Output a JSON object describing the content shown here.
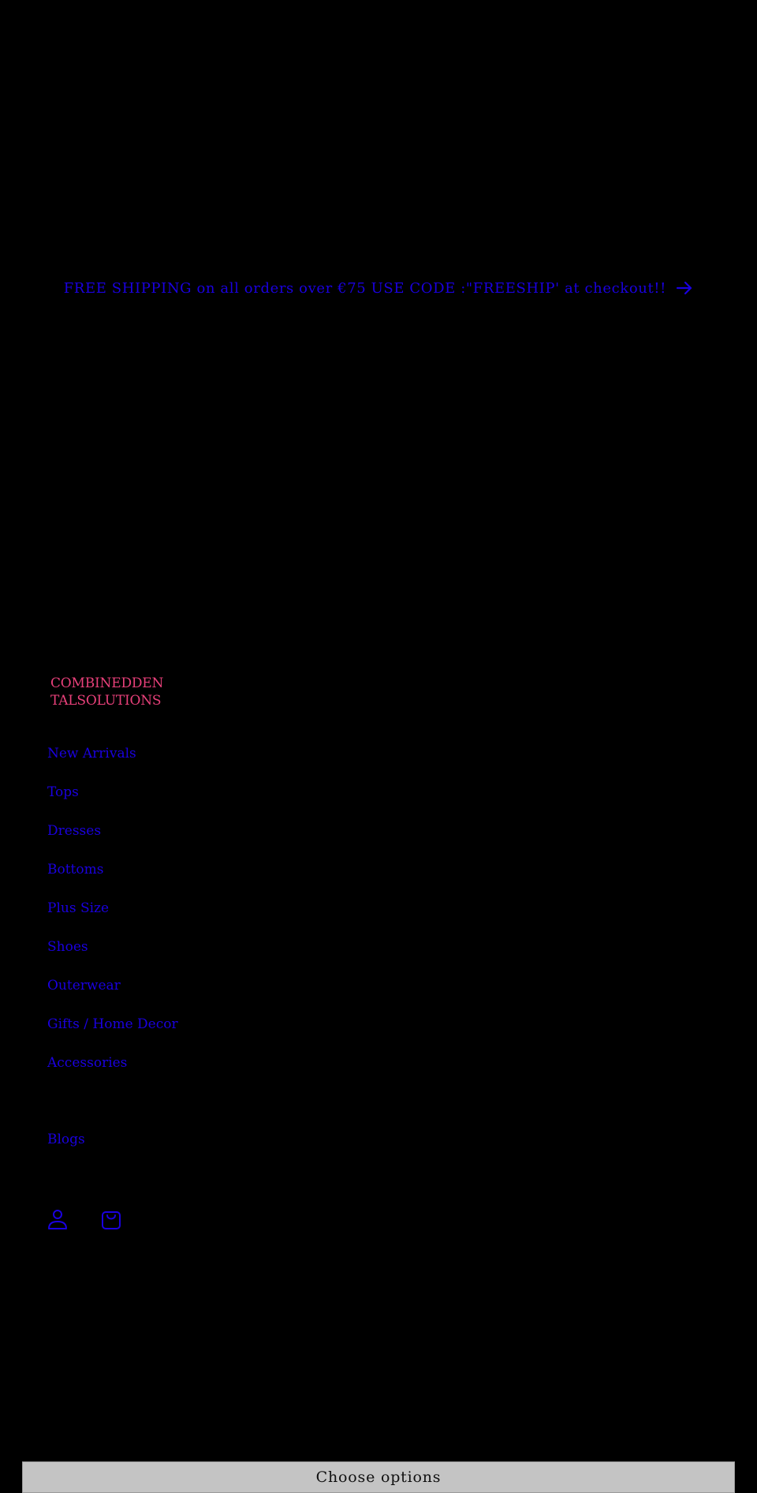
{
  "announcement": {
    "text": "FREE SHIPPING on all orders over €75 USE CODE :\"FREESHIP' at checkout!!",
    "arrow_icon": "arrow-right-icon"
  },
  "logo": {
    "line1": "COMBINEDDEN",
    "line2": "TALSOLUTIONS",
    "color": "#e8407a"
  },
  "nav": {
    "items": [
      {
        "label": "New Arrivals"
      },
      {
        "label": "Tops"
      },
      {
        "label": "Dresses"
      },
      {
        "label": "Bottoms"
      },
      {
        "label": "Plus Size"
      },
      {
        "label": "Shoes"
      },
      {
        "label": "Outerwear"
      },
      {
        "label": "Gifts / Home Decor"
      },
      {
        "label": "Accessories"
      },
      {
        "label": "Blogs"
      }
    ]
  },
  "header_icons": {
    "account": "account-icon",
    "cart": "cart-icon"
  },
  "product": {
    "choose_options_label": "Choose options"
  },
  "colors": {
    "background": "#000000",
    "link": "#1a00e0",
    "logo": "#e8407a",
    "button_bg": "#c4c4c4"
  }
}
